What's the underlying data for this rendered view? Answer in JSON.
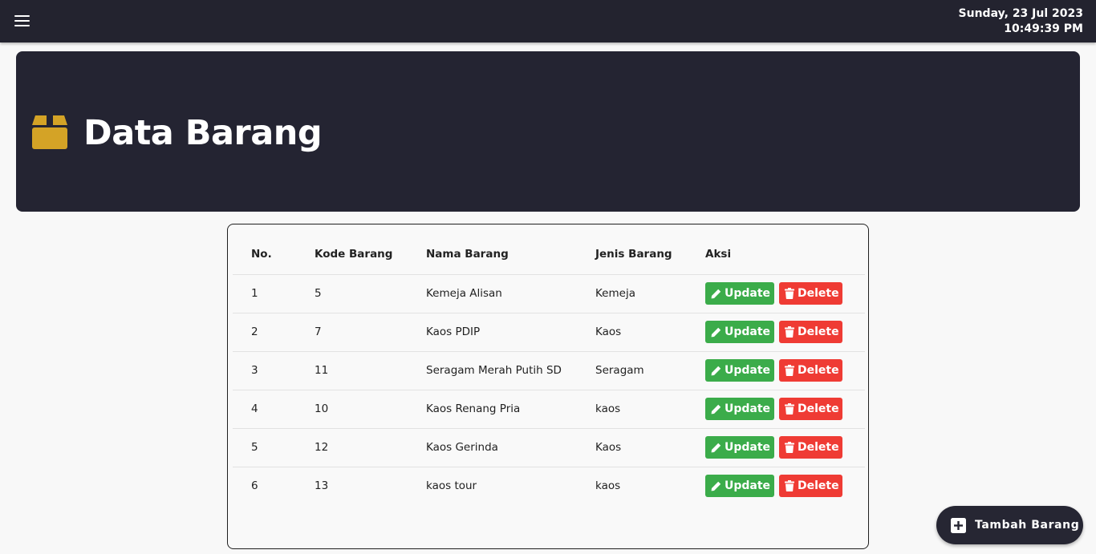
{
  "topbar": {
    "menu_icon": "hamburger-icon",
    "date": "Sunday, 23 Jul 2023",
    "time": "10:49:39 PM"
  },
  "hero": {
    "icon": "box-icon",
    "icon_color": "#d4a326",
    "title": "Data Barang"
  },
  "table": {
    "headers": [
      "No.",
      "Kode Barang",
      "Nama Barang",
      "Jenis Barang",
      "Aksi"
    ],
    "rows": [
      {
        "no": "1",
        "kode": "5",
        "nama": "Kemeja Alisan",
        "jenis": "Kemeja",
        "update": "Update",
        "delete": "Delete"
      },
      {
        "no": "2",
        "kode": "7",
        "nama": "Kaos PDIP",
        "jenis": "Kaos",
        "update": "Update",
        "delete": "Delete"
      },
      {
        "no": "3",
        "kode": "11",
        "nama": "Seragam Merah Putih SD",
        "jenis": "Seragam",
        "update": "Update",
        "delete": "Delete"
      },
      {
        "no": "4",
        "kode": "10",
        "nama": "Kaos Renang Pria",
        "jenis": "kaos",
        "update": "Update",
        "delete": "Delete"
      },
      {
        "no": "5",
        "kode": "12",
        "nama": "Kaos Gerinda",
        "jenis": "Kaos",
        "update": "Update",
        "delete": "Delete"
      },
      {
        "no": "6",
        "kode": "13",
        "nama": "kaos tour",
        "jenis": "kaos",
        "update": "Update",
        "delete": "Delete"
      }
    ]
  },
  "colors": {
    "update": "#3bac4a",
    "delete": "#ef3b34",
    "dark": "#242432"
  },
  "fab": {
    "icon": "plus-square-icon",
    "label": "Tambah Barang"
  }
}
